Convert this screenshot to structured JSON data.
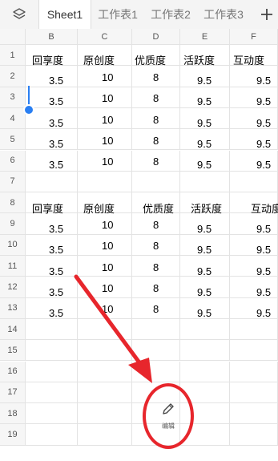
{
  "sheet_tabs": [
    "Sheet1",
    "工作表1",
    "工作表2",
    "工作表3"
  ],
  "columns": [
    "B",
    "C",
    "D",
    "E",
    "F"
  ],
  "rows": [
    "1",
    "2",
    "3",
    "4",
    "5",
    "6",
    "7",
    "8",
    "9",
    "10",
    "11",
    "12",
    "13",
    "14",
    "15",
    "16",
    "17",
    "18",
    "19"
  ],
  "table1": {
    "headers": [
      "回享度",
      "原创度",
      "优质度",
      "活跃度",
      "互动度"
    ],
    "data": [
      [
        "3.5",
        "10",
        "8",
        "9.5",
        "9.5"
      ],
      [
        "3.5",
        "10",
        "8",
        "9.5",
        "9.5"
      ],
      [
        "3.5",
        "10",
        "8",
        "9.5",
        "9.5"
      ],
      [
        "3.5",
        "10",
        "8",
        "9.5",
        "9.5"
      ],
      [
        "3.5",
        "10",
        "8",
        "9.5",
        "9.5"
      ]
    ]
  },
  "table2": {
    "headers": [
      "回享度",
      "原创度",
      "优质度",
      "活跃度",
      "互动度"
    ],
    "data": [
      [
        "3.5",
        "10",
        "8",
        "9.5",
        "9.5"
      ],
      [
        "3.5",
        "10",
        "8",
        "9.5",
        "9.5"
      ],
      [
        "3.5",
        "10",
        "8",
        "9.5",
        "9.5"
      ],
      [
        "3.5",
        "10",
        "8",
        "9.5",
        "9.5"
      ],
      [
        "3.5",
        "10",
        "8",
        "9.5",
        "9.5"
      ]
    ]
  },
  "edit_button": {
    "label": "编辑",
    "icon": "pencil-icon"
  },
  "colors": {
    "accent": "#2a7ff2",
    "annotation": "#e7262c"
  }
}
